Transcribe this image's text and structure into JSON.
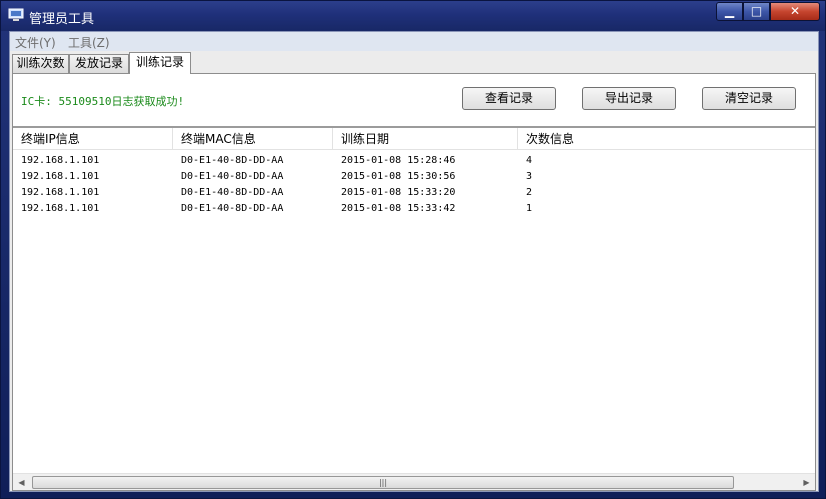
{
  "window": {
    "title": "管理员工具",
    "min": "▁",
    "max": "□",
    "close": "✕"
  },
  "menu": {
    "file": "文件(Y)",
    "tools": "工具(Z)"
  },
  "tabs": [
    {
      "label": "训练次数"
    },
    {
      "label": "发放记录"
    },
    {
      "label": "训练记录"
    }
  ],
  "status": "IC卡: 55109510日志获取成功!",
  "buttons": {
    "view": "查看记录",
    "export": "导出记录",
    "clear": "清空记录"
  },
  "table": {
    "columns": [
      "终端IP信息",
      "终端MAC信息",
      "训练日期",
      "次数信息"
    ],
    "rows": [
      [
        "192.168.1.101",
        "D0-E1-40-8D-DD-AA",
        "2015-01-08 15:28:46",
        "4"
      ],
      [
        "192.168.1.101",
        "D0-E1-40-8D-DD-AA",
        "2015-01-08 15:30:56",
        "3"
      ],
      [
        "192.168.1.101",
        "D0-E1-40-8D-DD-AA",
        "2015-01-08 15:33:20",
        "2"
      ],
      [
        "192.168.1.101",
        "D0-E1-40-8D-DD-AA",
        "2015-01-08 15:33:42",
        "1"
      ]
    ]
  },
  "scrollbar": {
    "left": "◀",
    "right": "▶",
    "grip": "|||"
  },
  "colors": {
    "status_text": "#1a8a1a",
    "titlebar": "#1f307a",
    "close_button": "#c6452f"
  },
  "icons": {
    "app": "computer-monitor-icon"
  }
}
